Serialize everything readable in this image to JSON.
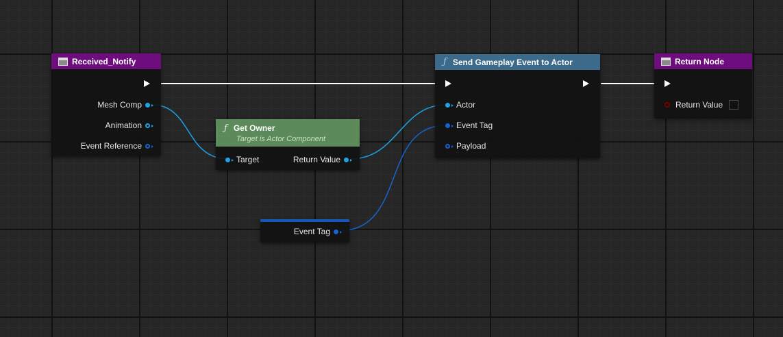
{
  "nodes": {
    "received_notify": {
      "title": "Received_Notify",
      "pins": [
        "Mesh Comp",
        "Animation",
        "Event Reference"
      ]
    },
    "get_owner": {
      "title": "Get Owner",
      "subtitle": "Target is Actor Component",
      "input": "Target",
      "output": "Return Value"
    },
    "event_tag_var": {
      "label": "Event Tag"
    },
    "send_gameplay_event": {
      "title": "Send Gameplay Event to Actor",
      "pins": [
        "Actor",
        "Event Tag",
        "Payload"
      ]
    },
    "return_node": {
      "title": "Return Node",
      "pin": "Return Value"
    }
  },
  "colors": {
    "event_header": "#6e0e7e",
    "function_header": "#3b6a8a",
    "pure_header": "#5d8a5a",
    "object_pin": "#20a2e6",
    "struct_pin": "#1565d0",
    "exec_wire": "#ffffff",
    "bool_pin": "#7a0000"
  },
  "icons": {
    "event": "event-node-icon",
    "function": "function-icon",
    "return": "return-node-icon"
  }
}
